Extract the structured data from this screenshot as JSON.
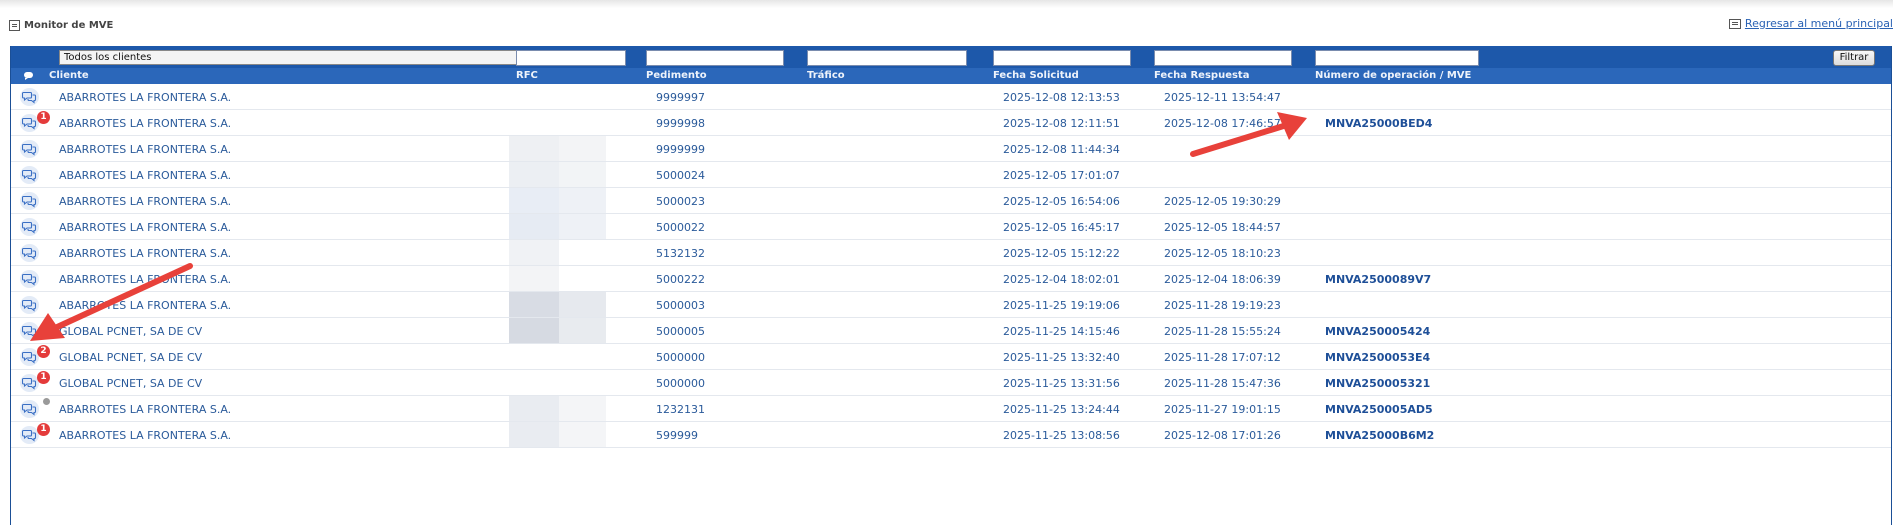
{
  "page": {
    "title": "Monitor de MVE",
    "back_link": "Regresar al menú principal"
  },
  "filters": {
    "client_select": "Todos los clientes",
    "filter_button": "Filtrar"
  },
  "columns": {
    "cliente": "Cliente",
    "rfc": "RFC",
    "pedimento": "Pedimento",
    "trafico": "Tráfico",
    "fecha_solicitud": "Fecha Solicitud",
    "fecha_respuesta": "Fecha Respuesta",
    "operacion": "Número de operación / MVE"
  },
  "rows": [
    {
      "cliente": "ABARROTES LA FRONTERA S.A.",
      "pedimento": "9999997",
      "fecha_solicitud": "2025-12-08 12:13:53",
      "fecha_respuesta": "2025-12-11 13:54:47",
      "operacion": "",
      "badge": "",
      "rfc_shade": [
        "#ffffff",
        "#ffffff"
      ]
    },
    {
      "cliente": "ABARROTES LA FRONTERA S.A.",
      "pedimento": "9999998",
      "fecha_solicitud": "2025-12-08 12:11:51",
      "fecha_respuesta": "2025-12-08 17:46:57",
      "operacion": "MNVA25000BED4",
      "badge": "1",
      "rfc_shade": [
        "#ffffff",
        "#ffffff"
      ]
    },
    {
      "cliente": "ABARROTES LA FRONTERA S.A.",
      "pedimento": "9999999",
      "fecha_solicitud": "2025-12-08 11:44:34",
      "fecha_respuesta": "",
      "operacion": "",
      "badge": "",
      "rfc_shade": [
        "#eef0f3",
        "#f3f4f6"
      ]
    },
    {
      "cliente": "ABARROTES LA FRONTERA S.A.",
      "pedimento": "5000024",
      "fecha_solicitud": "2025-12-05 17:01:07",
      "fecha_respuesta": "",
      "operacion": "",
      "badge": "",
      "rfc_shade": [
        "#eceff3",
        "#f2f4f6"
      ]
    },
    {
      "cliente": "ABARROTES LA FRONTERA S.A.",
      "pedimento": "5000023",
      "fecha_solicitud": "2025-12-05 16:54:06",
      "fecha_respuesta": "2025-12-05 19:30:29",
      "operacion": "",
      "badge": "",
      "rfc_shade": [
        "#e8edf5",
        "#eef1f6"
      ]
    },
    {
      "cliente": "ABARROTES LA FRONTERA S.A.",
      "pedimento": "5000022",
      "fecha_solicitud": "2025-12-05 16:45:17",
      "fecha_respuesta": "2025-12-05 18:44:57",
      "operacion": "",
      "badge": "",
      "rfc_shade": [
        "#e6ebf3",
        "#eef1f6"
      ]
    },
    {
      "cliente": "ABARROTES LA FRONTERA S.A.",
      "pedimento": "5132132",
      "fecha_solicitud": "2025-12-05 15:12:22",
      "fecha_respuesta": "2025-12-05 18:10:23",
      "operacion": "",
      "badge": "",
      "rfc_shade": [
        "#f0f2f5",
        "#ffffff"
      ]
    },
    {
      "cliente": "ABARROTES LA FRONTERA S.A.",
      "pedimento": "5000222",
      "fecha_solicitud": "2025-12-04 18:02:01",
      "fecha_respuesta": "2025-12-04 18:06:39",
      "operacion": "MNVA2500089V7",
      "badge": "",
      "rfc_shade": [
        "#f3f4f6",
        "#ffffff"
      ]
    },
    {
      "cliente": "ABARROTES LA FRONTERA S.A.",
      "pedimento": "5000003",
      "fecha_solicitud": "2025-11-25 19:19:06",
      "fecha_respuesta": "2025-11-28 19:19:23",
      "operacion": "",
      "badge": "",
      "rfc_shade": [
        "#d8dce4",
        "#e6e9ee"
      ]
    },
    {
      "cliente": "GLOBAL PCNET, SA DE CV",
      "pedimento": "5000005",
      "fecha_solicitud": "2025-11-25 14:15:46",
      "fecha_respuesta": "2025-11-28 15:55:24",
      "operacion": "MNVA250005424",
      "badge": "",
      "rfc_shade": [
        "#d6dae2",
        "#e8ebef"
      ]
    },
    {
      "cliente": "GLOBAL PCNET, SA DE CV",
      "pedimento": "5000000",
      "fecha_solicitud": "2025-11-25 13:32:40",
      "fecha_respuesta": "2025-11-28 17:07:12",
      "operacion": "MNVA2500053E4",
      "badge": "2",
      "rfc_shade": [
        "#ffffff",
        "#ffffff"
      ]
    },
    {
      "cliente": "GLOBAL PCNET, SA DE CV",
      "pedimento": "5000000",
      "fecha_solicitud": "2025-11-25 13:31:56",
      "fecha_respuesta": "2025-11-28 15:47:36",
      "operacion": "MNVA250005321",
      "badge": "1",
      "rfc_shade": [
        "#ffffff",
        "#ffffff"
      ]
    },
    {
      "cliente": "ABARROTES LA FRONTERA S.A.",
      "pedimento": "1232131",
      "fecha_solicitud": "2025-11-25 13:24:44",
      "fecha_respuesta": "2025-11-27 19:01:15",
      "operacion": "MNVA250005AD5",
      "badge": "dot",
      "rfc_shade": [
        "#e9ecf1",
        "#f4f5f7"
      ]
    },
    {
      "cliente": "ABARROTES LA FRONTERA S.A.",
      "pedimento": "599999",
      "fecha_solicitud": "2025-11-25 13:08:56",
      "fecha_respuesta": "2025-12-08 17:01:26",
      "operacion": "MNVA25000B6M2",
      "badge": "1",
      "rfc_shade": [
        "#e9ecf1",
        "#f4f5f7"
      ]
    }
  ],
  "colors": {
    "header_bg": "#2b67ba",
    "filter_bg": "#1d58aa",
    "badge": "#e43b3b",
    "arrow": "#e8413a"
  },
  "icons": {
    "chat": "chat-bubbles-icon",
    "title": "list-icon",
    "back": "list-icon"
  }
}
